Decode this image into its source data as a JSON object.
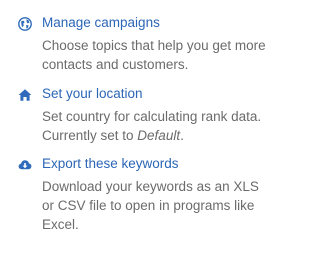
{
  "items": [
    {
      "icon": "globe-icon",
      "title": "Manage campaigns",
      "description": "Choose topics that help you get more contacts and customers."
    },
    {
      "icon": "home-icon",
      "title": "Set your location",
      "description_prefix": "Set country for calculating rank data. Currently set to ",
      "description_emphasis": "Default",
      "description_suffix": "."
    },
    {
      "icon": "cloud-download-icon",
      "title": "Export these keywords",
      "description": "Download your keywords as an XLS or CSV file to open in programs like Excel."
    }
  ],
  "colors": {
    "link": "#2b66b6",
    "icon": "#2f6bba",
    "description": "#6b6b6b",
    "background": "#ffffff"
  }
}
